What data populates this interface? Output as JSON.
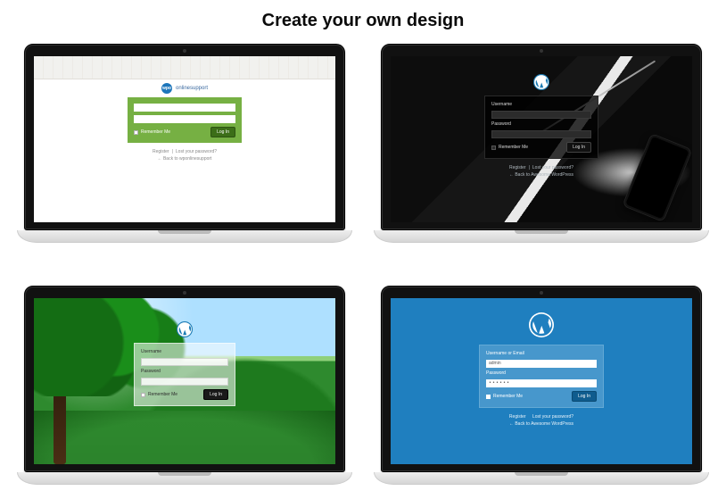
{
  "heading": "Create your own design",
  "wp_letter": "W",
  "screens": {
    "s1": {
      "brand_badge": "wpo",
      "brand_text": "onlinesupport",
      "remember": "Remember Me",
      "button": "Log In",
      "link_register": "Register",
      "link_lost": "Lost your password?",
      "link_back": "← Back to wponlinesupport"
    },
    "s2": {
      "label_user": "Username",
      "label_pass": "Password",
      "remember": "Remember Me",
      "button": "Log In",
      "link_register": "Register",
      "link_lost": "Lost your password?",
      "link_back": "← Back to Awesome WordPress"
    },
    "s3": {
      "label_user": "Username",
      "label_pass": "Password",
      "remember": "Remember Me",
      "button": "Log In"
    },
    "s4": {
      "label_user": "Username or Email",
      "value_user": "admin",
      "label_pass": "Password",
      "value_pass": "••••••",
      "remember": "Remember Me",
      "button": "Log In",
      "link_register": "Register",
      "link_lost": "Lost your password?",
      "link_back": "← Back to Awesome WordPress"
    }
  }
}
